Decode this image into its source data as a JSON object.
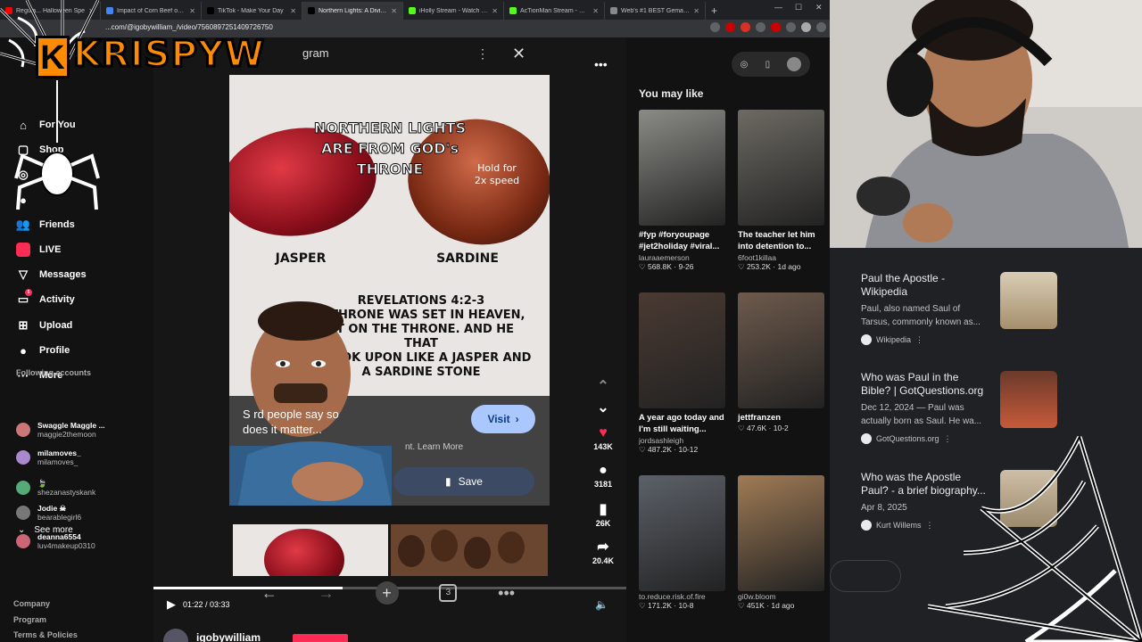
{
  "browser": {
    "tabs": [
      {
        "title": "Regula... Halloween Spe",
        "color": "#ff0000"
      },
      {
        "title": "Impact of Corn Beef on Ame",
        "color": "#4285f4"
      },
      {
        "title": "TikTok - Make Your Day",
        "color": "#000000"
      },
      {
        "title": "Northern Lights: A Divine Spe",
        "color": "#000000",
        "active": true
      },
      {
        "title": "iHolly Stream - Watch Live on",
        "color": "#53fc18"
      },
      {
        "title": "AcTionMan Stream - Watch Li",
        "color": "#53fc18"
      },
      {
        "title": "Web's #1 BEST Gematria Cal",
        "color": "#888888"
      }
    ],
    "new_tab": "+",
    "url": "...com/@igobywilliam_/video/7560897251409726750"
  },
  "overlay": {
    "logo_text": "KRISPYW",
    "logo_letter": "K"
  },
  "sidebar": {
    "items": [
      {
        "label": "For You",
        "icon": "home-icon"
      },
      {
        "label": "Shop",
        "icon": "shop-icon"
      },
      {
        "label": "",
        "icon": "explore-icon"
      },
      {
        "label": "",
        "icon": "following-icon"
      },
      {
        "label": "Friends",
        "icon": "friends-icon"
      },
      {
        "label": "LIVE",
        "icon": "live-icon"
      },
      {
        "label": "Messages",
        "icon": "messages-icon"
      },
      {
        "label": "Activity",
        "icon": "activity-icon",
        "badge": "5"
      },
      {
        "label": "Upload",
        "icon": "upload-icon"
      },
      {
        "label": "Profile",
        "icon": "profile-icon"
      },
      {
        "label": "More",
        "icon": "more-icon"
      }
    ],
    "following_title": "Following accounts",
    "accounts": [
      {
        "name": "Swaggle Maggle ...",
        "handle": "maggie2themoon",
        "color": "#c77"
      },
      {
        "name": "milamoves_",
        "handle": "milamoves_",
        "color": "#a8c"
      },
      {
        "name": "🍃",
        "handle": "shezanastyskank",
        "color": "#5a7"
      },
      {
        "name": "Jodie ☠",
        "handle": "bearablegirl6",
        "color": "#777"
      },
      {
        "name": "deanna6554",
        "handle": "luv4makeup0310",
        "color": "#c67"
      }
    ],
    "see_more": "See more",
    "footer": [
      "Company",
      "Program",
      "Terms & Policies"
    ]
  },
  "video": {
    "header_label": "gram",
    "top_text": [
      "NORTHERN LIGHTS",
      "ARE FROM GOD's",
      "THRONE"
    ],
    "speed_hint": [
      "Hold for",
      "2x speed"
    ],
    "stone_left": "JASPER",
    "stone_right": "SARDINE",
    "verse_ref": "REVELATIONS 4:2-3",
    "verse_lines": [
      "A THRONE WAS SET IN HEAVEN,",
      "AT ON THE THRONE. AND HE THAT",
      "O LOOK UPON LIKE A JASPER AND",
      "A SARDINE STONE"
    ],
    "caption_lines": [
      "S        rd people say so",
      "         does it matter..."
    ],
    "learn_more": "nt. Learn More",
    "visit_label": "Visit",
    "save_label": "Save",
    "time": "01:22 / 03:33",
    "progress": 0.4,
    "username": "igobywilliam"
  },
  "actions": {
    "likes": "143K",
    "comments": "3181",
    "saves": "26K",
    "shares": "20.4K"
  },
  "you_may_like": {
    "title": "You may like",
    "cards": [
      {
        "title": "#fyp #foryoupage #jet2holiday #viral...",
        "author": "lauraaemerson",
        "stats": "♡ 568.8K · 9-26",
        "bg": "#8b8b86"
      },
      {
        "title": "The teacher let him into detention to...",
        "author": "6foot1killaa",
        "stats": "♡ 253.2K · 1d ago",
        "bg": "#6d6a63"
      },
      {
        "title": "A year ago today and I'm still waiting...",
        "author": "jordsashleigh",
        "stats": "♡ 487.2K · 10-12",
        "bg": "#4a3a32"
      },
      {
        "title": "jettfranzen",
        "author": "",
        "stats": "♡ 47.6K · 10-2",
        "bg": "#6e5a4c"
      },
      {
        "title": "",
        "author": "to.reduce.risk.of.fire",
        "stats": "♡ 171.2K · 10-8",
        "bg": "#5c6169"
      },
      {
        "title": "",
        "author": "gi0w.bloom",
        "stats": "♡ 451K · 1d ago",
        "bg": "#a07b55"
      }
    ]
  },
  "search": {
    "results": [
      {
        "title": "Paul the Apostle - Wikipedia",
        "desc": "Paul, also named Saul of Tarsus, commonly known as...",
        "source": "Wikipedia"
      },
      {
        "title": "Who was Paul in the Bible? | GotQuestions.org",
        "desc": "Dec 12, 2024 — Paul was actually born as Saul. He wa...",
        "source": "GotQuestions.org"
      },
      {
        "title": "Who was the Apostle Paul? - a brief biography...",
        "desc": "Apr 8, 2025",
        "source": "Kurt Willems"
      }
    ]
  }
}
